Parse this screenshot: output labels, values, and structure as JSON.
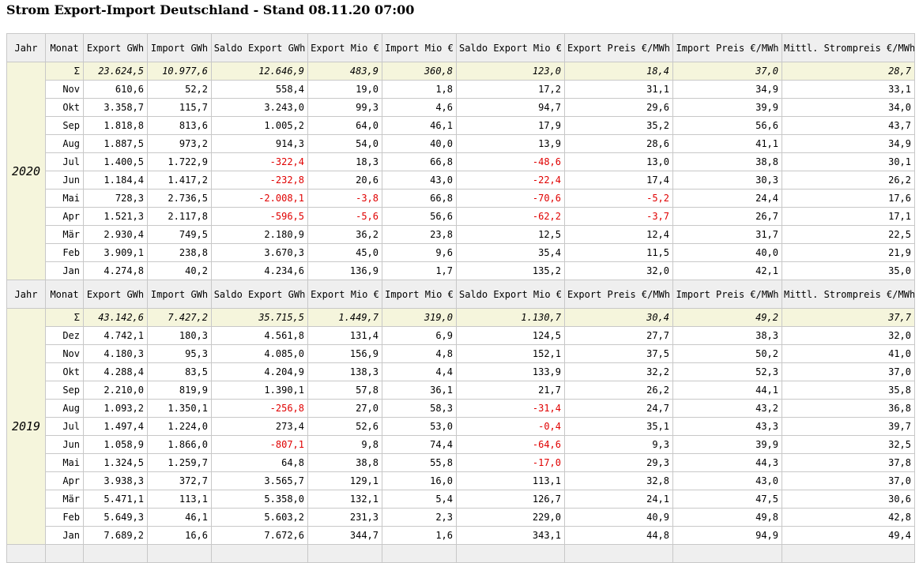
{
  "title": "Strom Export-Import Deutschland - Stand 08.11.20 07:00",
  "columns": [
    "Jahr",
    "Monat",
    "Export GWh",
    "Import GWh",
    "Saldo Export GWh",
    "Export Mio €",
    "Import Mio €",
    "Saldo Export Mio €",
    "Export Preis €/MWh",
    "Import Preis €/MWh",
    "Mittl. Strompreis €/MWh"
  ],
  "years": [
    {
      "year": "2020",
      "sum": [
        "Σ",
        "23.624,5",
        "10.977,6",
        "12.646,9",
        "483,9",
        "360,8",
        "123,0",
        "18,4",
        "37,0",
        "28,7"
      ],
      "rows": [
        [
          "Nov",
          "610,6",
          "52,2",
          "558,4",
          "19,0",
          "1,8",
          "17,2",
          "31,1",
          "34,9",
          "33,1"
        ],
        [
          "Okt",
          "3.358,7",
          "115,7",
          "3.243,0",
          "99,3",
          "4,6",
          "94,7",
          "29,6",
          "39,9",
          "34,0"
        ],
        [
          "Sep",
          "1.818,8",
          "813,6",
          "1.005,2",
          "64,0",
          "46,1",
          "17,9",
          "35,2",
          "56,6",
          "43,7"
        ],
        [
          "Aug",
          "1.887,5",
          "973,2",
          "914,3",
          "54,0",
          "40,0",
          "13,9",
          "28,6",
          "41,1",
          "34,9"
        ],
        [
          "Jul",
          "1.400,5",
          "1.722,9",
          "-322,4",
          "18,3",
          "66,8",
          "-48,6",
          "13,0",
          "38,8",
          "30,1"
        ],
        [
          "Jun",
          "1.184,4",
          "1.417,2",
          "-232,8",
          "20,6",
          "43,0",
          "-22,4",
          "17,4",
          "30,3",
          "26,2"
        ],
        [
          "Mai",
          "728,3",
          "2.736,5",
          "-2.008,1",
          "-3,8",
          "66,8",
          "-70,6",
          "-5,2",
          "24,4",
          "17,6"
        ],
        [
          "Apr",
          "1.521,3",
          "2.117,8",
          "-596,5",
          "-5,6",
          "56,6",
          "-62,2",
          "-3,7",
          "26,7",
          "17,1"
        ],
        [
          "Mär",
          "2.930,4",
          "749,5",
          "2.180,9",
          "36,2",
          "23,8",
          "12,5",
          "12,4",
          "31,7",
          "22,5"
        ],
        [
          "Feb",
          "3.909,1",
          "238,8",
          "3.670,3",
          "45,0",
          "9,6",
          "35,4",
          "11,5",
          "40,0",
          "21,9"
        ],
        [
          "Jan",
          "4.274,8",
          "40,2",
          "4.234,6",
          "136,9",
          "1,7",
          "135,2",
          "32,0",
          "42,1",
          "35,0"
        ]
      ]
    },
    {
      "year": "2019",
      "sum": [
        "Σ",
        "43.142,6",
        "7.427,2",
        "35.715,5",
        "1.449,7",
        "319,0",
        "1.130,7",
        "30,4",
        "49,2",
        "37,7"
      ],
      "rows": [
        [
          "Dez",
          "4.742,1",
          "180,3",
          "4.561,8",
          "131,4",
          "6,9",
          "124,5",
          "27,7",
          "38,3",
          "32,0"
        ],
        [
          "Nov",
          "4.180,3",
          "95,3",
          "4.085,0",
          "156,9",
          "4,8",
          "152,1",
          "37,5",
          "50,2",
          "41,0"
        ],
        [
          "Okt",
          "4.288,4",
          "83,5",
          "4.204,9",
          "138,3",
          "4,4",
          "133,9",
          "32,2",
          "52,3",
          "37,0"
        ],
        [
          "Sep",
          "2.210,0",
          "819,9",
          "1.390,1",
          "57,8",
          "36,1",
          "21,7",
          "26,2",
          "44,1",
          "35,8"
        ],
        [
          "Aug",
          "1.093,2",
          "1.350,1",
          "-256,8",
          "27,0",
          "58,3",
          "-31,4",
          "24,7",
          "43,2",
          "36,8"
        ],
        [
          "Jul",
          "1.497,4",
          "1.224,0",
          "273,4",
          "52,6",
          "53,0",
          "-0,4",
          "35,1",
          "43,3",
          "39,7"
        ],
        [
          "Jun",
          "1.058,9",
          "1.866,0",
          "-807,1",
          "9,8",
          "74,4",
          "-64,6",
          "9,3",
          "39,9",
          "32,5"
        ],
        [
          "Mai",
          "1.324,5",
          "1.259,7",
          "64,8",
          "38,8",
          "55,8",
          "-17,0",
          "29,3",
          "44,3",
          "37,8"
        ],
        [
          "Apr",
          "3.938,3",
          "372,7",
          "3.565,7",
          "129,1",
          "16,0",
          "113,1",
          "32,8",
          "43,0",
          "37,0"
        ],
        [
          "Mär",
          "5.471,1",
          "113,1",
          "5.358,0",
          "132,1",
          "5,4",
          "126,7",
          "24,1",
          "47,5",
          "30,6"
        ],
        [
          "Feb",
          "5.649,3",
          "46,1",
          "5.603,2",
          "231,3",
          "2,3",
          "229,0",
          "40,9",
          "49,8",
          "42,8"
        ],
        [
          "Jan",
          "7.689,2",
          "16,6",
          "7.672,6",
          "344,7",
          "1,6",
          "343,1",
          "44,8",
          "94,9",
          "49,4"
        ]
      ]
    }
  ]
}
